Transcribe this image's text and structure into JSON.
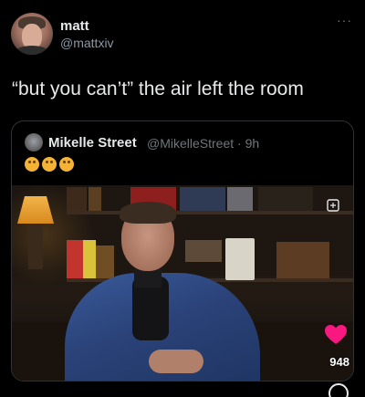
{
  "tweet": {
    "author_name": "matt",
    "author_handle": "@mattxiv",
    "more": "···",
    "text": "“but you can’t” the air left the room"
  },
  "quote": {
    "author_name": "Mikelle Street",
    "author_meta": "@MikelleStreet · 9h",
    "emoji_count": 3,
    "video": {
      "view_count": "948",
      "icons": [
        "mute-icon",
        "heart-icon"
      ]
    }
  },
  "colors": {
    "background": "#000000",
    "text": "#e7e9ea",
    "secondary": "#71767b",
    "heart": "#f91880"
  }
}
